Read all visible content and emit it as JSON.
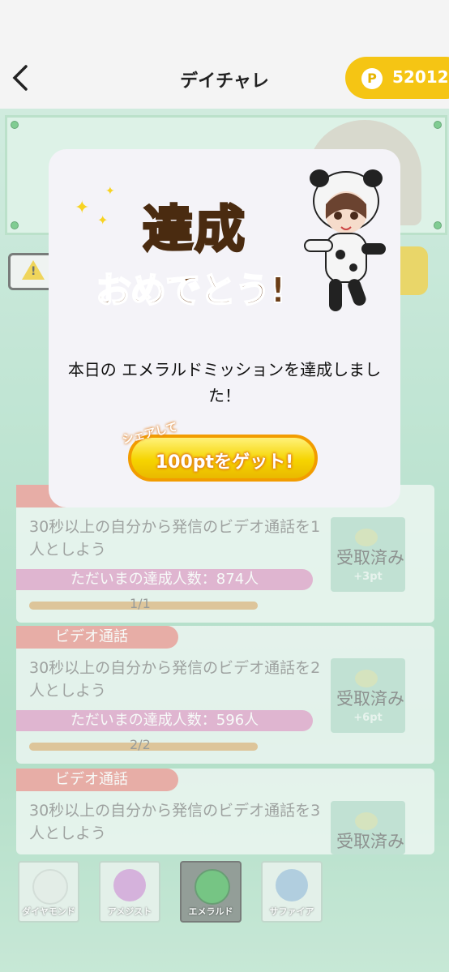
{
  "header": {
    "title": "デイチャレ",
    "points_symbol": "P",
    "points": "52012"
  },
  "modal": {
    "headline": "達成",
    "subheadline": "おめでとう!",
    "message": "本日の エメラルドミッションを達成しました！",
    "share_small": "シェアして",
    "share_main": "100ptをゲット!"
  },
  "missions": [
    {
      "category": "",
      "description": "30秒以上の自分から発信のビデオ通話を1人としよう",
      "achievers": "ただいまの達成人数：874人",
      "progress_text": "1/1",
      "progress": 1.0,
      "claim_label": "受取済み",
      "reward": "+3pt"
    },
    {
      "category": "ビデオ通話",
      "description": "30秒以上の自分から発信のビデオ通話を2人としよう",
      "achievers": "ただいまの達成人数：596人",
      "progress_text": "2/2",
      "progress": 1.0,
      "claim_label": "受取済み",
      "reward": "+6pt"
    },
    {
      "category": "ビデオ通話",
      "description": "30秒以上の自分から発信のビデオ通話を3人としよう",
      "achievers": "",
      "progress_text": "",
      "progress": null,
      "claim_label": "受取済み",
      "reward": ""
    }
  ],
  "tabs": [
    {
      "label": "ダイヤモンド",
      "color": "#dfe8e2",
      "active": false
    },
    {
      "label": "アメジスト",
      "color": "#c98ad0",
      "active": false
    },
    {
      "label": "エメラルド",
      "color": "#2fa843",
      "active": true
    },
    {
      "label": "サファイア",
      "color": "#8fb6d6",
      "active": false
    }
  ],
  "colors": {
    "accent_yellow": "#f5c514",
    "tag": "#e5827a",
    "achievers_bar": "#d98fbd"
  }
}
